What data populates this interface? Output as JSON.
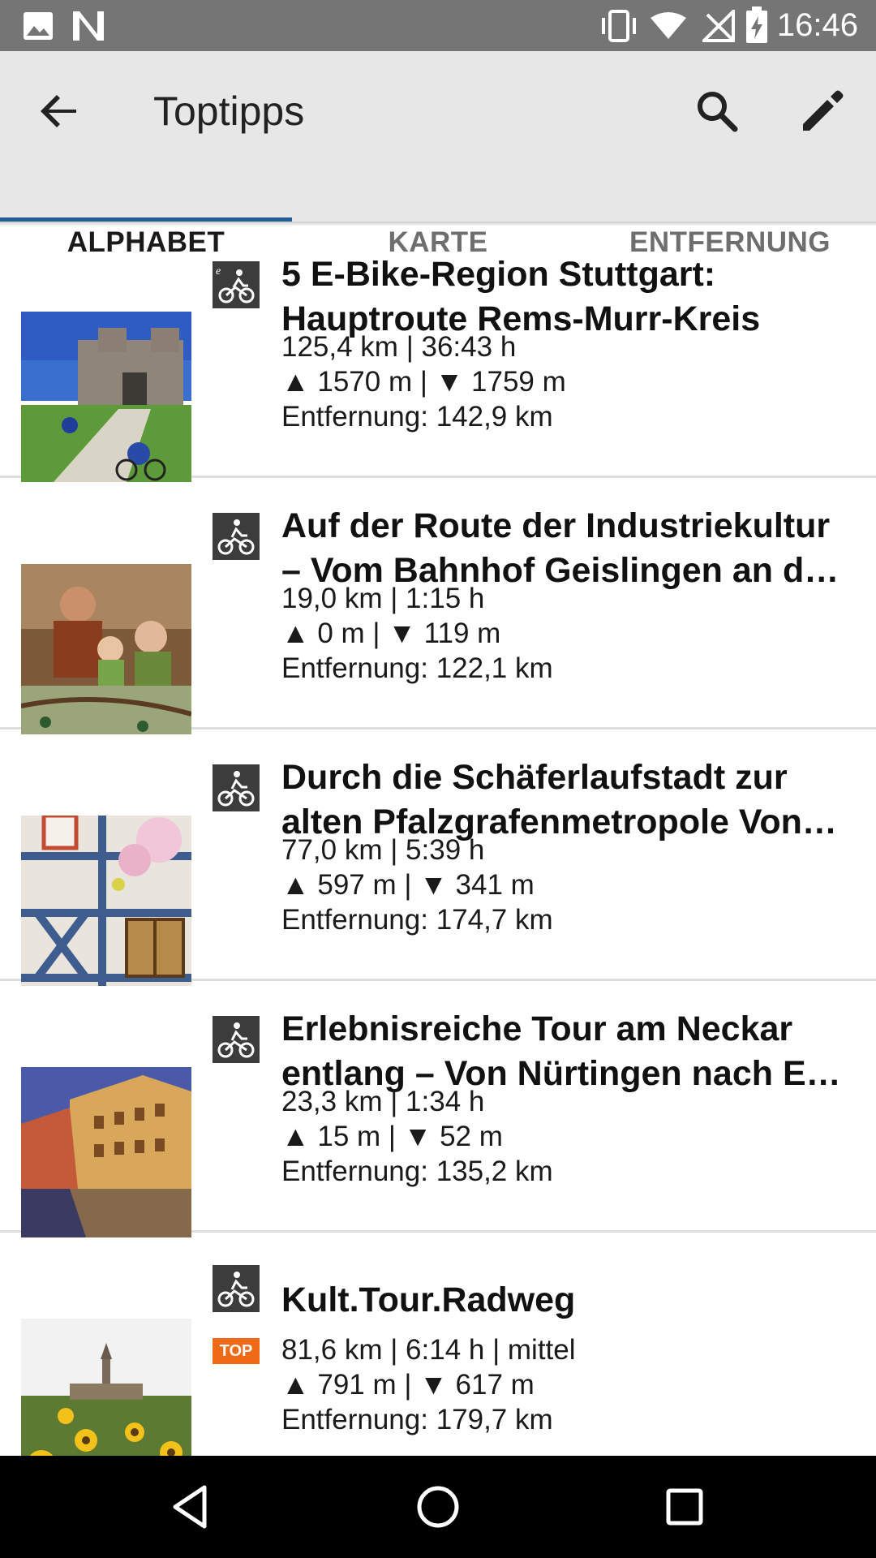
{
  "status_bar": {
    "time": "16:46",
    "left_icons": [
      "image-icon",
      "n-icon"
    ],
    "right_icons": [
      "vibrate-icon",
      "wifi-icon",
      "no-signal-icon",
      "battery-charging-icon"
    ]
  },
  "app_bar": {
    "title": "Toptipps",
    "icons": [
      "back-arrow-icon",
      "search-icon",
      "edit-pencil-icon"
    ],
    "background": "#e7e7e7"
  },
  "tabs": [
    {
      "label": "ALPHABET",
      "selected": true
    },
    {
      "label": "KARTE",
      "selected": false
    },
    {
      "label": "ENTFERNUNG",
      "selected": false
    }
  ],
  "accent_color": "#1f5f99",
  "items": [
    {
      "title_line1": "5 E-Bike-Region Stuttgart:",
      "title_line2": "Hauptroute Rems-Murr-Kreis",
      "stats": "125,4 km | 36:43 h",
      "elevation": "▲ 1570 m | ▼ 1759 m",
      "distance": "Entfernung: 142,9 km",
      "type_icon": "e-bike-icon",
      "top": false
    },
    {
      "title_line1": "Auf der Route der Industriekultur",
      "title_line2": "– Vom Bahnhof Geislingen an d…",
      "stats": "19,0 km | 1:15 h",
      "elevation": "▲ 0 m | ▼ 119 m",
      "distance": "Entfernung: 122,1 km",
      "type_icon": "bicycle-icon",
      "top": false
    },
    {
      "title_line1": "Durch die Schäferlaufstadt zur",
      "title_line2": "alten Pfalzgrafenmetropole Von…",
      "stats": "77,0 km | 5:39 h",
      "elevation": "▲ 597 m | ▼ 341 m",
      "distance": "Entfernung: 174,7 km",
      "type_icon": "bicycle-icon",
      "top": false
    },
    {
      "title_line1": "Erlebnisreiche Tour am Neckar",
      "title_line2": "entlang – Von Nürtingen nach E…",
      "stats": "23,3 km | 1:34 h",
      "elevation": "▲ 15 m | ▼ 52 m",
      "distance": "Entfernung: 135,2 km",
      "type_icon": "bicycle-icon",
      "top": false
    },
    {
      "title_line1": "Kult.Tour.Radweg",
      "stats": "81,6 km | 6:14 h | mittel",
      "elevation": "▲ 791 m | ▼ 617 m",
      "distance": "Entfernung: 179,7 km",
      "type_icon": "bicycle-icon",
      "top": true,
      "badge": "TOP"
    }
  ],
  "nav_bar": {
    "icons": [
      "back-triangle-icon",
      "home-circle-icon",
      "recents-square-icon"
    ]
  }
}
